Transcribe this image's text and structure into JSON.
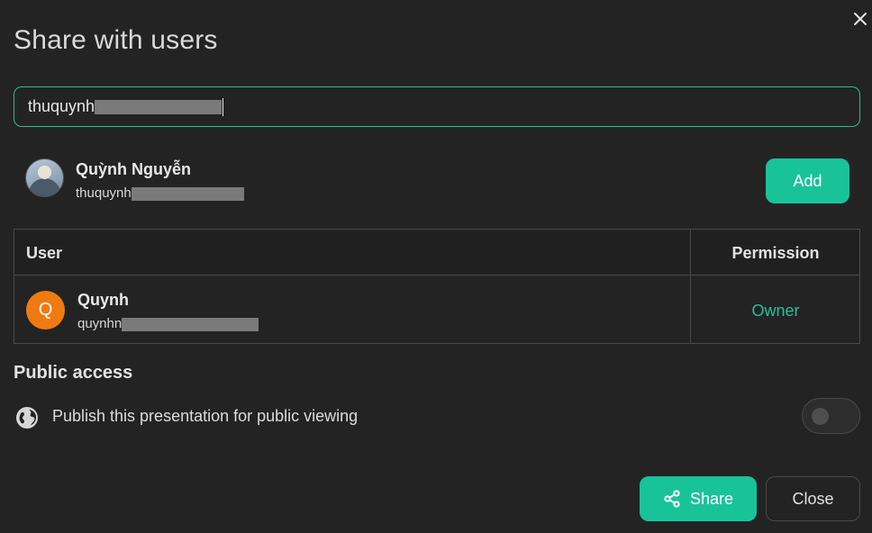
{
  "dialog": {
    "title": "Share with users"
  },
  "search": {
    "value_visible": "thuquynh"
  },
  "suggestion": {
    "name": "Quỳnh Nguyễn",
    "email_visible": "thuquynh",
    "add_label": "Add"
  },
  "table": {
    "headers": {
      "user": "User",
      "permission": "Permission"
    },
    "rows": [
      {
        "avatar_letter": "Q",
        "name": "Quynh",
        "email_visible": "quynhn",
        "permission": "Owner"
      }
    ]
  },
  "public_access": {
    "title": "Public access",
    "label": "Publish this presentation for public viewing",
    "enabled": false
  },
  "footer": {
    "share_label": "Share",
    "close_label": "Close"
  },
  "colors": {
    "accent": "#19c39a",
    "background": "#232323",
    "owner_text": "#2bbf95",
    "avatar_orange": "#f07a12"
  },
  "icons": [
    "close-icon",
    "globe-icon",
    "share-icon"
  ]
}
